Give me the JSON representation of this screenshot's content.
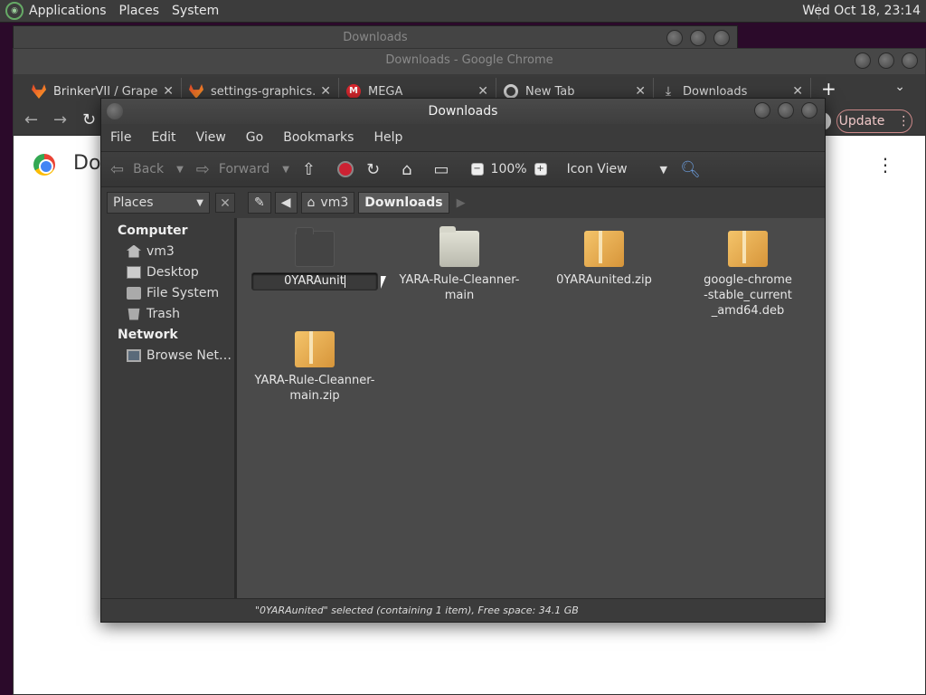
{
  "top_panel": {
    "menus": [
      "Applications",
      "Places",
      "System"
    ],
    "clock": "Wed Oct 18, 23:14"
  },
  "bg_window": {
    "title": "Downloads"
  },
  "chrome": {
    "title": "Downloads - Google Chrome",
    "tabs": [
      {
        "label": "BrinkerVII / Grapeju",
        "icon": "gitlab-icon"
      },
      {
        "label": "settings-graphics.p",
        "icon": "gitlab-icon"
      },
      {
        "label": "MEGA",
        "icon": "mega-icon"
      },
      {
        "label": "New Tab",
        "icon": "chrome-icon"
      },
      {
        "label": "Downloads",
        "icon": "download-icon"
      }
    ],
    "update_label": "Update",
    "page_title": "Dov"
  },
  "caja": {
    "title": "Downloads",
    "menus": [
      "File",
      "Edit",
      "View",
      "Go",
      "Bookmarks",
      "Help"
    ],
    "toolbar": {
      "back": "Back",
      "forward": "Forward",
      "zoom": "100%",
      "view_mode": "Icon View"
    },
    "places_label": "Places",
    "breadcrumb": [
      "vm3",
      "Downloads"
    ],
    "sidebar": {
      "computer_label": "Computer",
      "computer_items": [
        "vm3",
        "Desktop",
        "File System",
        "Trash"
      ],
      "network_label": "Network",
      "network_items": [
        "Browse Net…"
      ]
    },
    "files": [
      {
        "name": "0YARAunit",
        "type": "folder-dark",
        "renaming": true
      },
      {
        "name": "YARA-Rule-Cleanner-main",
        "type": "folder-light"
      },
      {
        "name": "0YARAunited.zip",
        "type": "package"
      },
      {
        "name": "google-chrome-stable_current_amd64.deb",
        "type": "package"
      },
      {
        "name": "YARA-Rule-Cleanner-main.zip",
        "type": "package"
      }
    ],
    "status": "\"0YARAunited\" selected (containing 1 item), Free space: 34.1 GB"
  }
}
